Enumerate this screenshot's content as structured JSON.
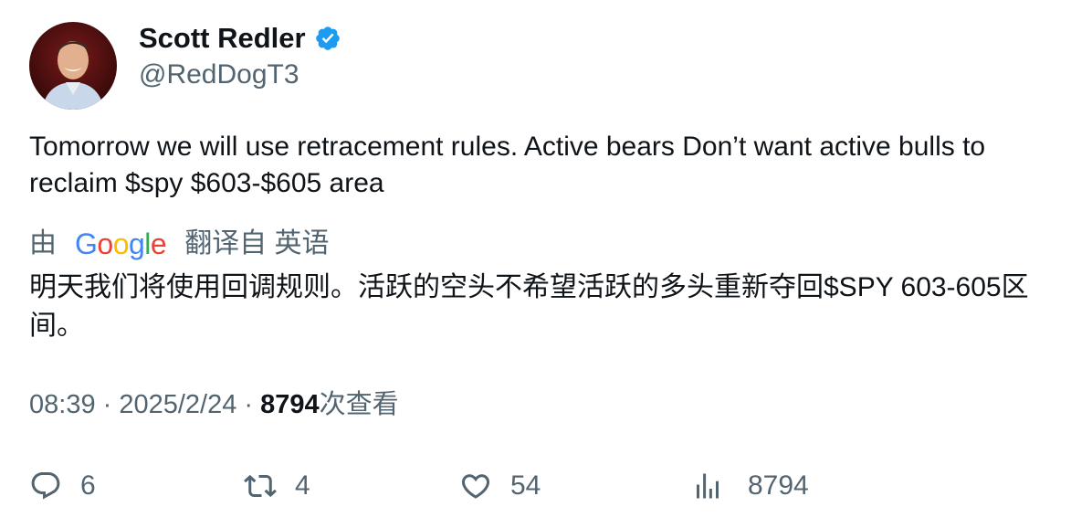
{
  "author": {
    "display_name": "Scott Redler",
    "handle": "@RedDogT3",
    "verified": true
  },
  "tweet": {
    "text": "Tomorrow we will use retracement rules. Active bears Don’t want active bulls to reclaim $spy $603-$605 area"
  },
  "translation": {
    "prefix": "由",
    "provider": "Google",
    "suffix": "翻译自 英语",
    "text": "明天我们将使用回调规则。活跃的空头不希望活跃的多头重新夺回$SPY 603-605区间。"
  },
  "meta": {
    "time": "08:39",
    "separator": " · ",
    "date": "2025/2/24",
    "views_count": "8794",
    "views_label": "次查看"
  },
  "actions": {
    "replies": "6",
    "retweets": "4",
    "likes": "54",
    "views": "8794"
  },
  "colors": {
    "text_primary": "#0f1419",
    "text_secondary": "#536471",
    "verified_blue": "#1d9bf0",
    "google_blue": "#4285F4",
    "google_red": "#EA4335",
    "google_yellow": "#FBBC05",
    "google_green": "#34A853"
  },
  "icons": {
    "reply": "reply-icon",
    "retweet": "retweet-icon",
    "like": "heart-icon",
    "views": "analytics-icon",
    "verified": "verified-badge-icon"
  }
}
